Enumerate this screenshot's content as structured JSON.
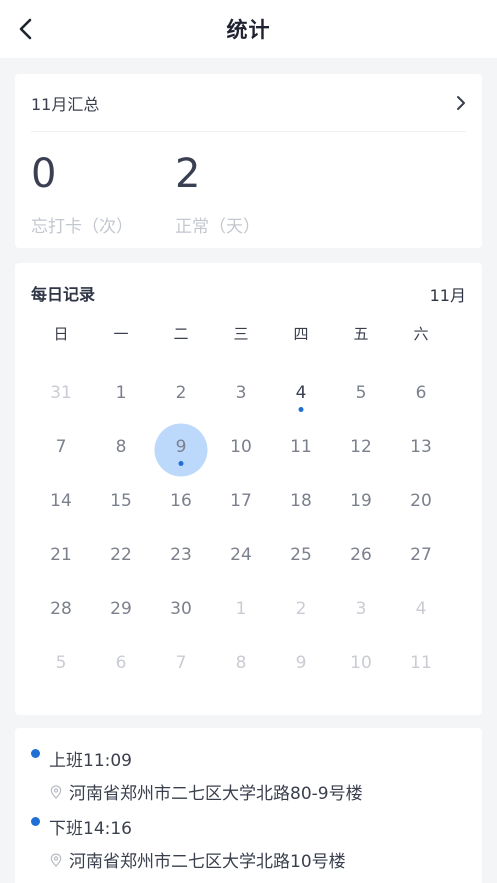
{
  "header": {
    "title": "统计",
    "back_icon": "chevron-left-icon"
  },
  "summary": {
    "title": "11月汇总",
    "stats": [
      {
        "value": "0",
        "label": "忘打卡（次）"
      },
      {
        "value": "2",
        "label": "正常（天）"
      }
    ]
  },
  "calendar": {
    "title": "每日记录",
    "month": "11月",
    "weekdays": [
      "日",
      "一",
      "二",
      "三",
      "四",
      "五",
      "六"
    ],
    "days": [
      {
        "label": "31",
        "other": true
      },
      {
        "label": "1"
      },
      {
        "label": "2"
      },
      {
        "label": "3"
      },
      {
        "label": "4",
        "today": true,
        "dot": true
      },
      {
        "label": "5"
      },
      {
        "label": "6"
      },
      {
        "label": "7"
      },
      {
        "label": "8"
      },
      {
        "label": "9",
        "selected": true,
        "dot": true
      },
      {
        "label": "10"
      },
      {
        "label": "11"
      },
      {
        "label": "12"
      },
      {
        "label": "13"
      },
      {
        "label": "14"
      },
      {
        "label": "15"
      },
      {
        "label": "16"
      },
      {
        "label": "17"
      },
      {
        "label": "18"
      },
      {
        "label": "19"
      },
      {
        "label": "20"
      },
      {
        "label": "21"
      },
      {
        "label": "22"
      },
      {
        "label": "23"
      },
      {
        "label": "24"
      },
      {
        "label": "25"
      },
      {
        "label": "26"
      },
      {
        "label": "27"
      },
      {
        "label": "28"
      },
      {
        "label": "29"
      },
      {
        "label": "30"
      },
      {
        "label": "1",
        "other": true
      },
      {
        "label": "2",
        "other": true
      },
      {
        "label": "3",
        "other": true
      },
      {
        "label": "4",
        "other": true
      },
      {
        "label": "5",
        "other": true
      },
      {
        "label": "6",
        "other": true
      },
      {
        "label": "7",
        "other": true
      },
      {
        "label": "8",
        "other": true
      },
      {
        "label": "9",
        "other": true
      },
      {
        "label": "10",
        "other": true
      },
      {
        "label": "11",
        "other": true
      }
    ]
  },
  "records": [
    {
      "time": "上班11:09",
      "address": "河南省郑州市二七区大学北路80-9号楼"
    },
    {
      "time": "下班14:16",
      "address": "河南省郑州市二七区大学北路10号楼"
    }
  ],
  "colors": {
    "accent": "#1f6fd6",
    "selected_bg": "#bcd8fb",
    "page_bg": "#f4f5f7"
  }
}
